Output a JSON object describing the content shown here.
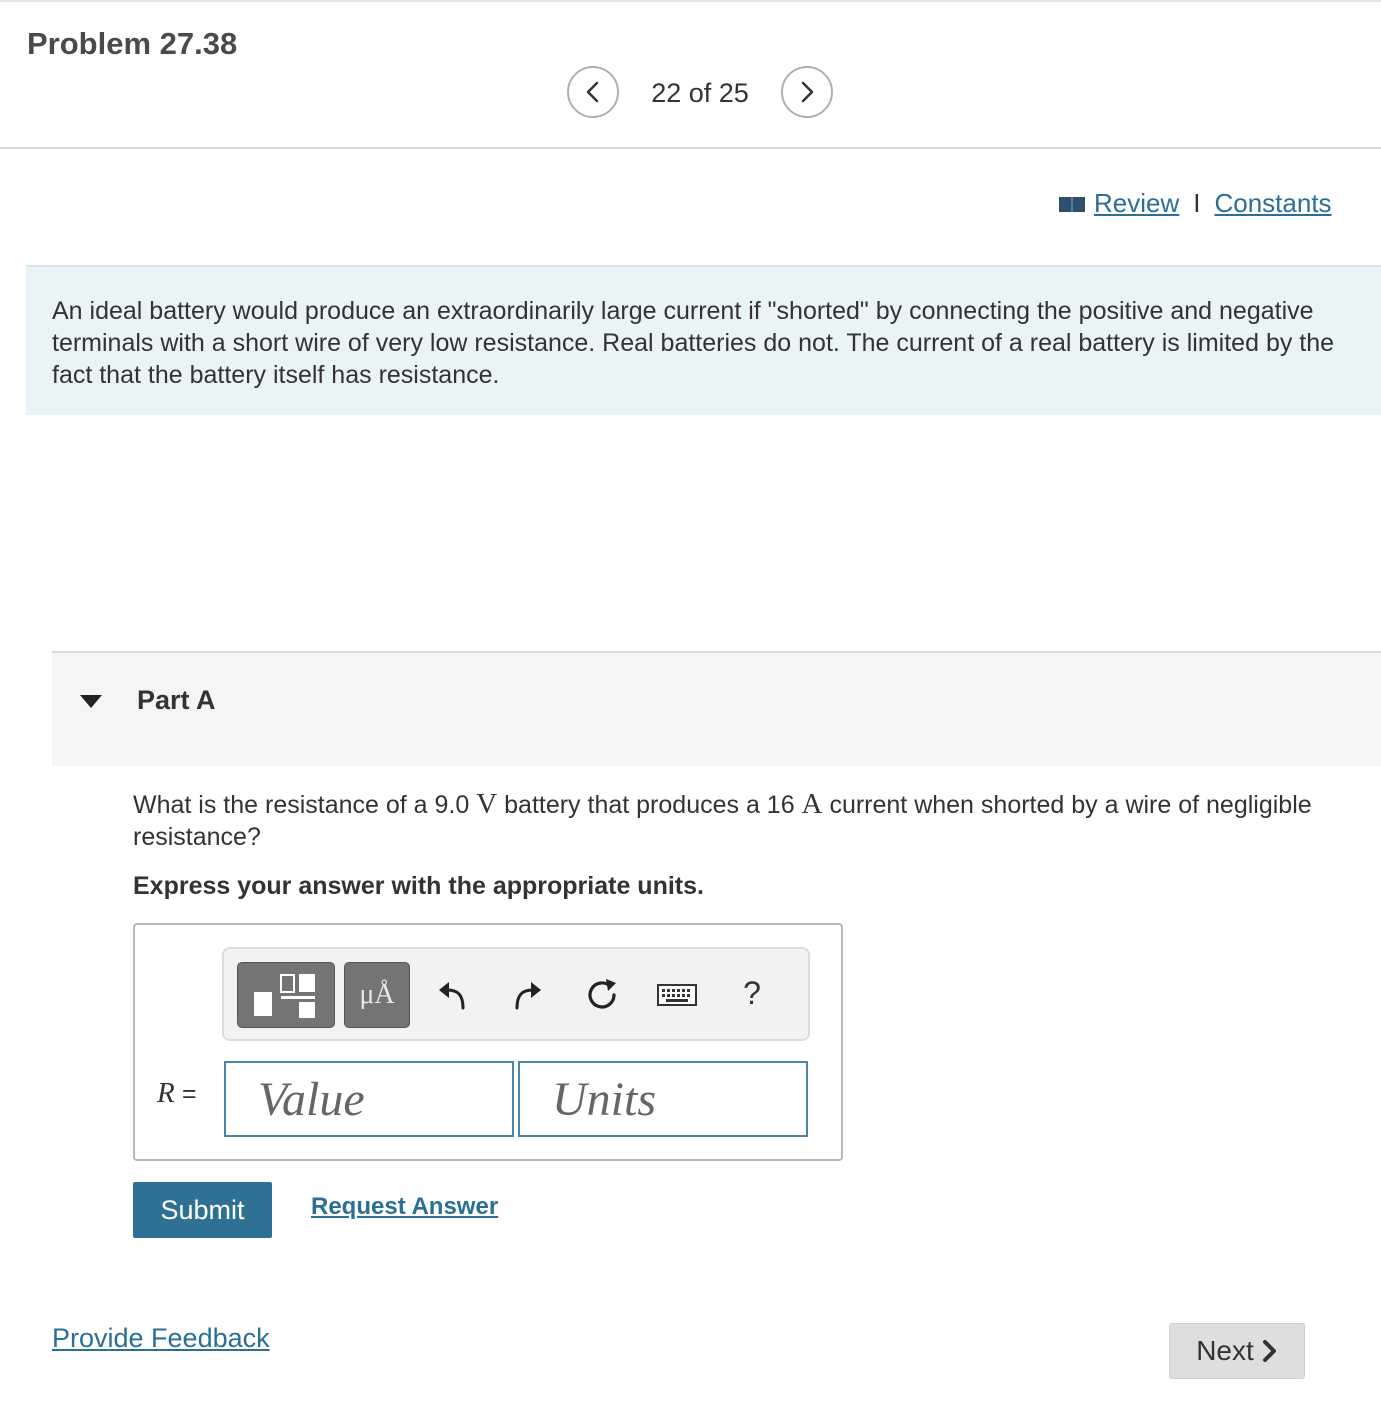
{
  "problem": {
    "title": "Problem 27.38"
  },
  "navigation": {
    "counter": "22 of 25"
  },
  "links": {
    "review": "Review",
    "separator": "I",
    "constants": "Constants"
  },
  "intro": {
    "text": "An ideal battery would produce an extraordinarily large current if \"shorted\" by connecting the positive and negative terminals with a short wire of very low resistance. Real batteries do not. The current of a real battery is limited by the fact that the battery itself has resistance."
  },
  "part": {
    "label": "Part A",
    "question": {
      "pre": "What is the resistance of a 9.0 ",
      "unit1": "V",
      "mid": " battery that produces a 16 ",
      "unit2": "A",
      "post": " current when shorted by a wire of negligible resistance?"
    },
    "instruction": "Express your answer with the appropriate units."
  },
  "answer": {
    "units_button_label": "μÅ",
    "help_label": "?",
    "variable": "R",
    "equals": "=",
    "value_placeholder": "Value",
    "units_placeholder": "Units"
  },
  "actions": {
    "submit": "Submit",
    "request_answer": "Request Answer",
    "provide_feedback": "Provide Feedback",
    "next": "Next"
  },
  "colors": {
    "accent": "#2e7195",
    "link": "#2a7095",
    "intro_background": "#e8f4f6"
  }
}
